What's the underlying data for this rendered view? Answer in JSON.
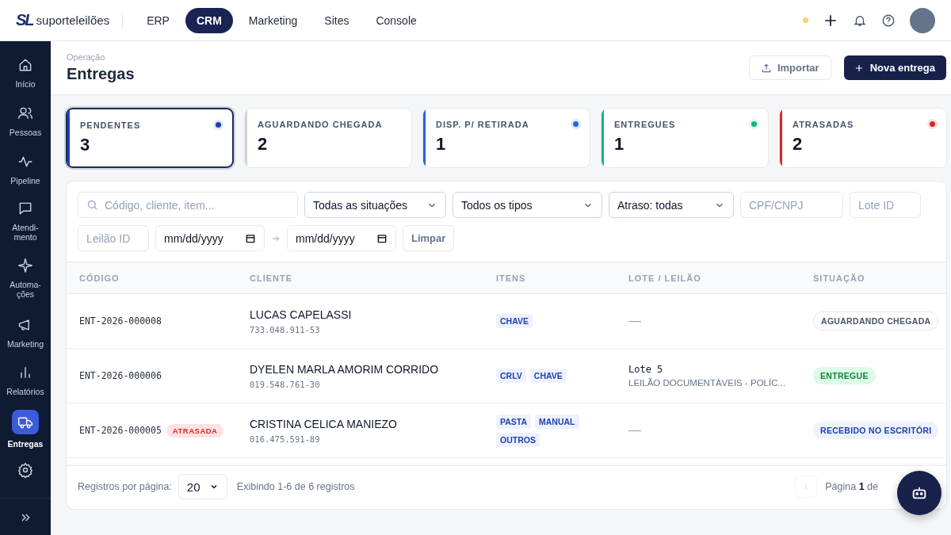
{
  "brand": {
    "mark": "SL",
    "name": "**suporte**leilões"
  },
  "nav_tabs": [
    {
      "label": "ERP",
      "selected": false
    },
    {
      "label": "CRM",
      "selected": true
    },
    {
      "label": "Marketing",
      "selected": false
    },
    {
      "label": "Sites",
      "selected": false
    },
    {
      "label": "Console",
      "selected": false
    }
  ],
  "sidebar": {
    "items": [
      {
        "label": "Início",
        "selected": false
      },
      {
        "label": "Pessoas",
        "selected": false
      },
      {
        "label": "Pipeline",
        "selected": false
      },
      {
        "label": "Atendi-\nmento",
        "selected": false
      },
      {
        "label": "Automa-\nções",
        "selected": false
      },
      {
        "label": "Marketing",
        "selected": false
      },
      {
        "label": "Relatórios",
        "selected": false
      },
      {
        "label": "Entregas",
        "selected": true
      },
      {
        "selected": false
      }
    ]
  },
  "header": {
    "breadcrumb": "Operação",
    "title": "Entregas",
    "import_button": "Importar",
    "new_button": "Nova entrega"
  },
  "stats": [
    {
      "label": "PENDENTES",
      "value": "3",
      "selected": true,
      "color": "#1e40af",
      "dot": true
    },
    {
      "label": "AGUARDANDO CHEGADA",
      "value": "2",
      "selected": false,
      "color": "#cbd5e1",
      "dot": false
    },
    {
      "label": "DISP. P/ RETIRADA",
      "value": "1",
      "selected": false,
      "color": "#2563eb",
      "dot": true
    },
    {
      "label": "ENTREGUES",
      "value": "1",
      "selected": false,
      "color": "#10b981",
      "dot": true
    },
    {
      "label": "ATRASADAS",
      "value": "2",
      "selected": false,
      "color": "#dc2626",
      "dot": true
    }
  ],
  "filters": {
    "search": {
      "placeholder": "Código, cliente, item..."
    },
    "status_select": "Todas as situações",
    "type_select": "Todos os tipos",
    "delay_select": "Atraso: todas",
    "cpf": {
      "placeholder": "CPF/CNPJ"
    },
    "lote": {
      "placeholder": "Lote ID"
    },
    "leilao": {
      "placeholder": "Leilão ID"
    },
    "date_from": "mm/dd/yyyy",
    "date_to": "mm/dd/yyyy",
    "clear_button": "Limpar"
  },
  "table": {
    "columns": [
      "CÓDIGO",
      "CLIENTE",
      "ITENS",
      "LOTE / LEILÃO",
      "SITUAÇÃO"
    ],
    "rows": [
      {
        "code": "ENT-2026-000008",
        "client": "LUCAS CAPELASSI",
        "document": "733.048.911-53",
        "items": [
          "CHAVE"
        ],
        "lot": "—",
        "status": "AGUARDANDO CHEGADA",
        "kind": "waiting"
      },
      {
        "code": "ENT-2026-000006",
        "client": "DYELEN MARLA AMORIM CORRIDO",
        "document": "019.548.761-30",
        "items": [
          "CRLV",
          "CHAVE"
        ],
        "lot": "Lote 5",
        "auction": "LEILÃO DOCUMENTÁVEIS - POLÍC...",
        "status": "ENTREGUE",
        "kind": "delivered"
      },
      {
        "code": "ENT-2026-000005",
        "late_badge": "ATRASADA",
        "client": "CRISTINA CELICA MANIEZO",
        "document": "016.475.591-89",
        "items": [
          "PASTA",
          "MANUAL",
          "OUTROS"
        ],
        "lot": "—",
        "status": "RECEBIDO NO ESCRITÓRI",
        "kind": "office"
      }
    ]
  },
  "footer": {
    "per_page_label": "Registros por página:",
    "per_page": "20",
    "summary": "Exibindo 1-6 de 6 registros",
    "page": "Página **1** de"
  }
}
